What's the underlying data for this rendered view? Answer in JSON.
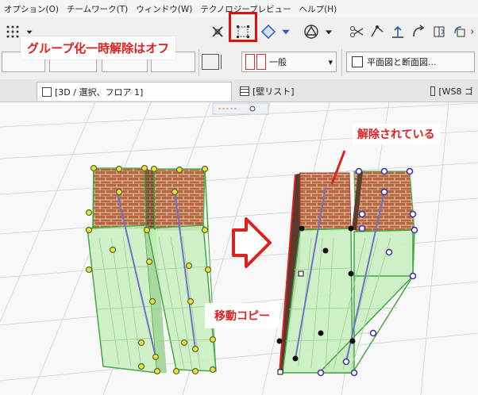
{
  "menu": {
    "items": [
      "オプション(O)",
      "チームワーク(T)",
      "ウィンドウ(W)",
      "テクノロジープレビュー",
      "ヘルプ(H)"
    ]
  },
  "toolbar2": {
    "layer_label": "一般",
    "view_label": "平面図と断面図..."
  },
  "tabs": [
    {
      "label": "[3D / 選択、フロア 1]"
    },
    {
      "label": "[壁リスト]"
    },
    {
      "label": "[WS8 ゴ"
    }
  ],
  "annotations": {
    "group_release": "グループ化一時解除はオフ",
    "released": "解除されている",
    "move_copy": "移動コピー"
  },
  "colors": {
    "accent_red": "#e02020",
    "selection_green": "#3fbf3f",
    "wall_glass": "#c9eec0",
    "brick": "#b5643c"
  },
  "icons": [
    "search-icon",
    "group-suspend-icon",
    "arrow-right-icon"
  ]
}
